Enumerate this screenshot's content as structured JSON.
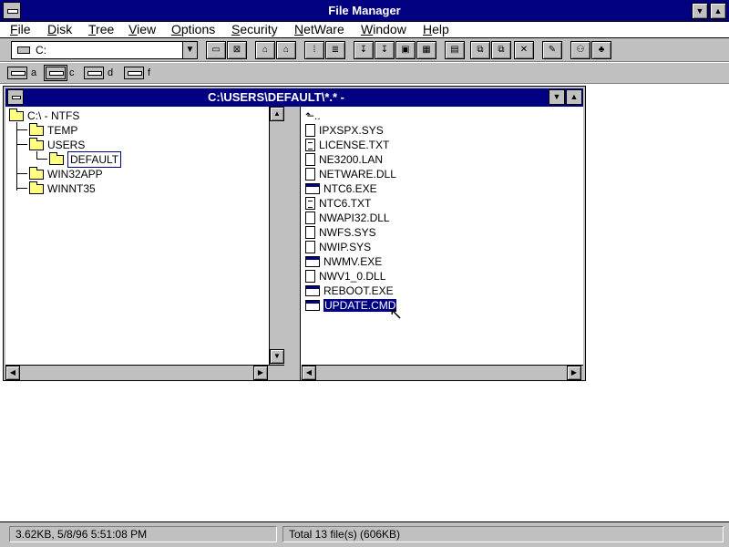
{
  "window": {
    "title": "File Manager"
  },
  "menu": [
    "File",
    "Disk",
    "Tree",
    "View",
    "Options",
    "Security",
    "NetWare",
    "Window",
    "Help"
  ],
  "toolbar": {
    "drive_value": "C:"
  },
  "drives": [
    {
      "letter": "a"
    },
    {
      "letter": "c"
    },
    {
      "letter": "d"
    },
    {
      "letter": "f"
    }
  ],
  "child": {
    "title": "C:\\USERS\\DEFAULT\\*.* -"
  },
  "tree": [
    {
      "label": "C:\\ - NTFS"
    },
    {
      "label": "TEMP"
    },
    {
      "label": "USERS"
    },
    {
      "label": "DEFAULT"
    },
    {
      "label": "WIN32APP"
    },
    {
      "label": "WINNT35"
    }
  ],
  "files": [
    {
      "name": "IPXSPX.SYS"
    },
    {
      "name": "LICENSE.TXT"
    },
    {
      "name": "NE3200.LAN"
    },
    {
      "name": "NETWARE.DLL"
    },
    {
      "name": "NTC6.EXE"
    },
    {
      "name": "NTC6.TXT"
    },
    {
      "name": "NWAPI32.DLL"
    },
    {
      "name": "NWFS.SYS"
    },
    {
      "name": "NWIP.SYS"
    },
    {
      "name": "NWMV.EXE"
    },
    {
      "name": "NWV1_0.DLL"
    },
    {
      "name": "REBOOT.EXE"
    },
    {
      "name": "UPDATE.CMD"
    }
  ],
  "status": {
    "left": "3.62KB, 5/8/96 5:51:08 PM",
    "right": "Total 13 file(s) (606KB)"
  }
}
